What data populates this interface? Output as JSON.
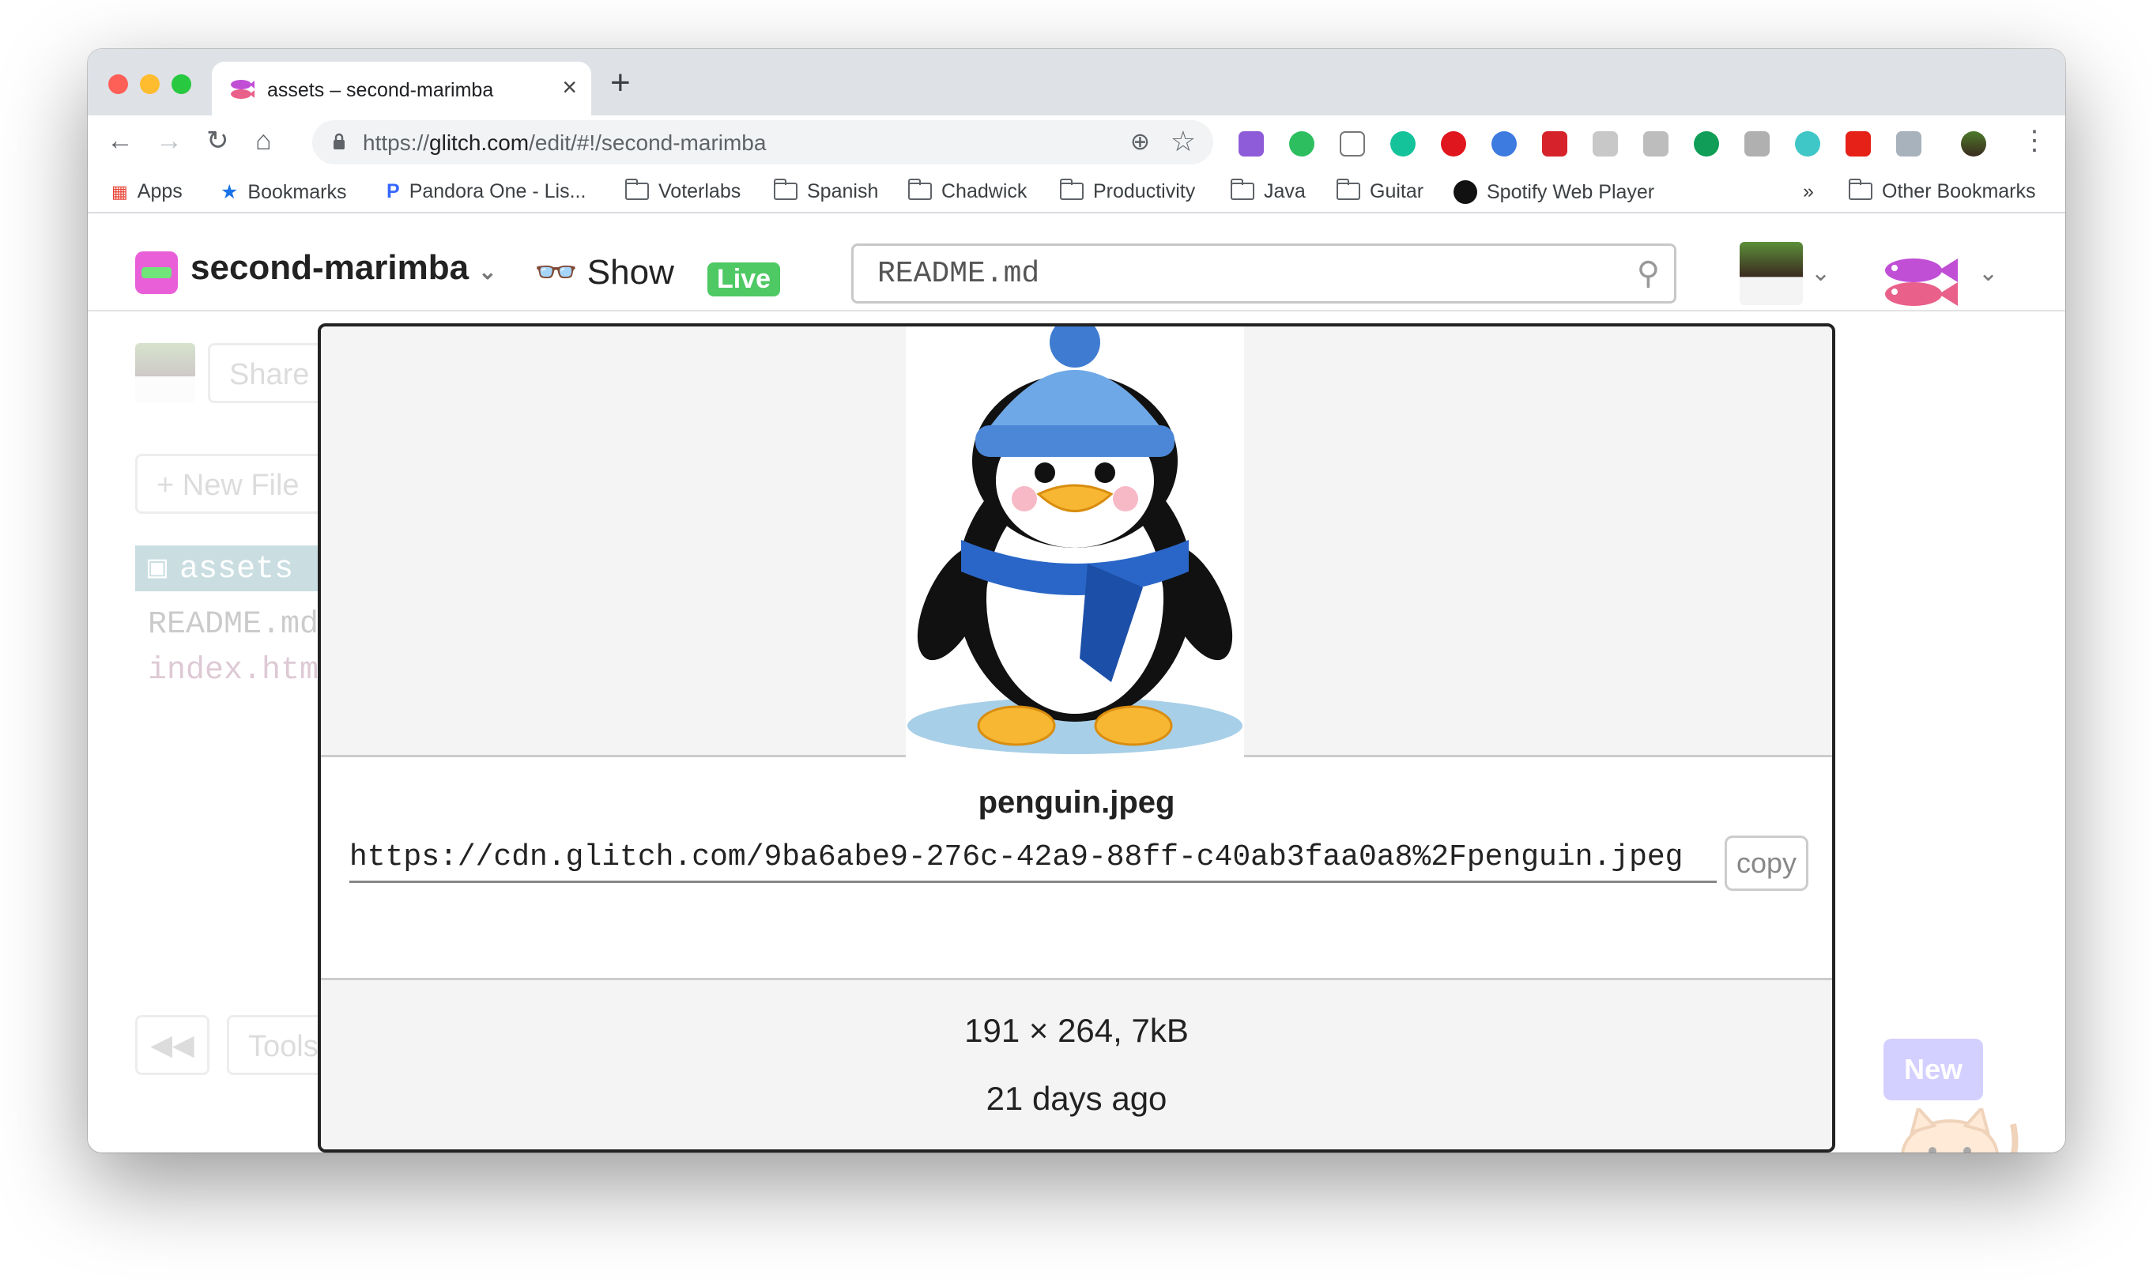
{
  "browser": {
    "tab_title": "assets – second-marimba",
    "new_tab": "+",
    "close": "×",
    "url_prefix": "https://",
    "url_host": "glitch.com",
    "url_path": "/edit/#!/second-marimba",
    "bookmarks": [
      "Apps",
      "Bookmarks",
      "Pandora One - Lis...",
      "Voterlabs",
      "Spanish",
      "Chadwick",
      "Productivity",
      "Java",
      "Guitar",
      "Spotify Web Player"
    ],
    "more": "»",
    "other_bookmarks": "Other Bookmarks"
  },
  "app": {
    "project_name": "second-marimba",
    "show_label": "Show",
    "live_badge": "Live",
    "search_value": "README.md",
    "sidebar": {
      "share": "Share",
      "new_file": "+ New File",
      "assets": "assets",
      "files": [
        "README.md",
        "index.htm"
      ],
      "tools": "Tools"
    },
    "new_badge": "New"
  },
  "asset": {
    "filename": "penguin.jpeg",
    "url": "https://cdn.glitch.com/9ba6abe9-276c-42a9-88ff-c40ab3faa0a8%2Fpenguin.jpeg",
    "copy_label": "copy",
    "dimensions": "191 × 264, 7kB",
    "age": "21 days ago"
  },
  "colors": {
    "live_green": "#4ec964",
    "glitch_pink": "#e95fd8",
    "new_badge": "#c9c4ff"
  }
}
